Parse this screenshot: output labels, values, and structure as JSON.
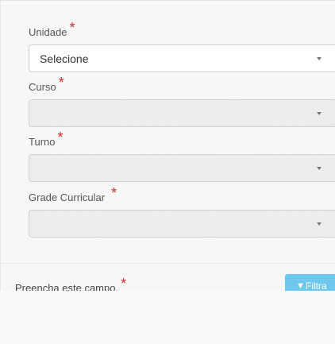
{
  "form": {
    "required_marker": "*",
    "unidade": {
      "label": "Unidade",
      "value": "Selecione"
    },
    "curso": {
      "label": "Curso",
      "value": ""
    },
    "turno": {
      "label": "Turno",
      "value": ""
    },
    "grade": {
      "label": "Grade Curricular",
      "value": ""
    }
  },
  "footer": {
    "validation_text": "Preencha este campo.",
    "filter_button": {
      "label": "Filtra",
      "icon": "filter-icon"
    }
  },
  "colors": {
    "required": "#c9302c",
    "button": "#6ec8ee"
  }
}
